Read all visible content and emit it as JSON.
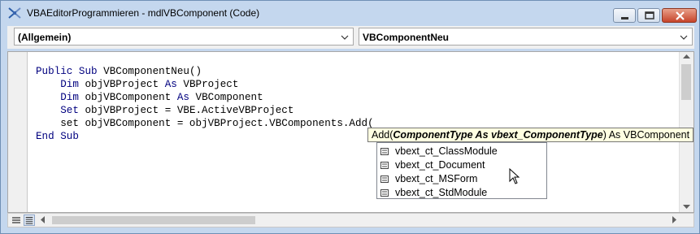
{
  "window": {
    "title": "VBAEditorProgrammieren - mdlVBComponent (Code)"
  },
  "combos": {
    "object": "(Allgemein)",
    "procedure": "VBComponentNeu"
  },
  "code": {
    "lines": [
      [
        {
          "t": "Public Sub ",
          "k": true
        },
        {
          "t": "VBComponentNeu()",
          "k": false
        }
      ],
      [
        {
          "t": "    Dim ",
          "k": true
        },
        {
          "t": "objVBProject ",
          "k": false
        },
        {
          "t": "As ",
          "k": true
        },
        {
          "t": "VBProject",
          "k": false
        }
      ],
      [
        {
          "t": "    Dim ",
          "k": true
        },
        {
          "t": "objVBComponent ",
          "k": false
        },
        {
          "t": "As ",
          "k": true
        },
        {
          "t": "VBComponent",
          "k": false
        }
      ],
      [
        {
          "t": "    Set ",
          "k": true
        },
        {
          "t": "objVBProject = VBE.ActiveVBProject",
          "k": false
        }
      ],
      [
        {
          "t": "    set objVBComponent = objVBProject.VBComponents.Add(",
          "k": false
        }
      ],
      [
        {
          "t": "End Sub",
          "k": true
        }
      ]
    ]
  },
  "tooltip": {
    "prefix": "Add(",
    "param": "ComponentType As vbext_ComponentType",
    "suffix": ") As VBComponent"
  },
  "autocomplete": {
    "items": [
      "vbext_ct_ClassModule",
      "vbext_ct_Document",
      "vbext_ct_MSForm",
      "vbext_ct_StdModule"
    ]
  },
  "colors": {
    "keyword": "#00007f",
    "tooltip_bg": "#ffffe1",
    "title_bg": "#c4d7ee"
  }
}
